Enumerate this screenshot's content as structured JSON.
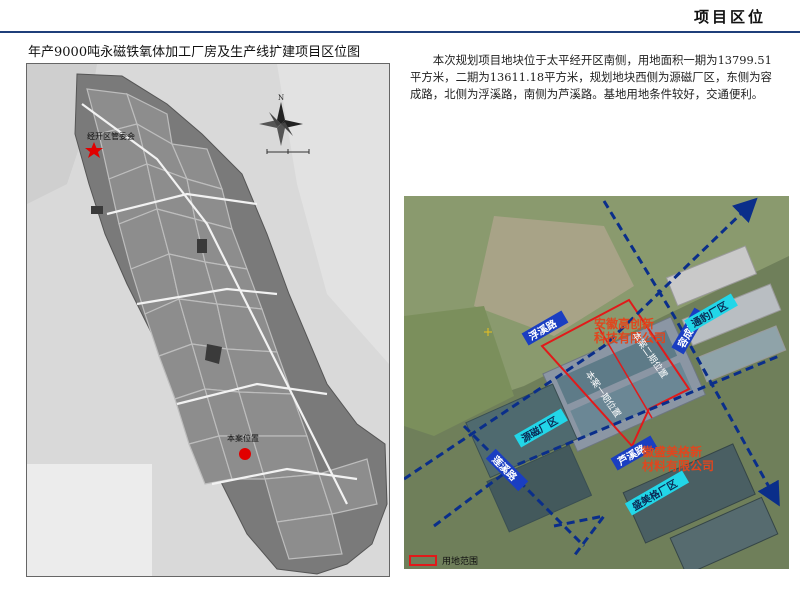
{
  "header": {
    "title": "项目区位"
  },
  "left_map": {
    "title": "年产9000吨永磁铁氧体加工厂房及生产线扩建项目区位图",
    "labels": {
      "committee": "经开区管委会",
      "project_location": "本案位置",
      "north_letter": "N"
    }
  },
  "description": {
    "text": "本次规划项目地块位于太平经开区南侧，用地面积一期为13799.51平方米，二期为13611.18平方米，规划地块西侧为源磁厂区，东侧为容成路，北侧为浮溪路，南侧为芦溪路。基地用地条件较好，交通便利。"
  },
  "satellite": {
    "roads": {
      "fuxi": "浮溪路",
      "rongcheng": "容成路",
      "luxi": "芦溪路",
      "lianxi": "莲溪路"
    },
    "zones": {
      "tongbao": "通豹厂区",
      "yuanci": "源磁厂区",
      "shengmeige": "盛美格厂区"
    },
    "companies": {
      "anhui_chuangxin": "安徽高创新\n科技有限公司",
      "shengmeige": "徽盛美格新\n材料有限公司"
    },
    "phases": {
      "phase1": "本案一期位置",
      "phase2": "本案二期位置"
    },
    "legend": {
      "label": "用地范围"
    }
  },
  "colors": {
    "accent_rule": "#1f3f7a",
    "road_badge": "#1a3ec2",
    "zone_badge": "#22d6e8",
    "boundary": "#e11a1a",
    "route_arrow": "#0a2e8a"
  }
}
